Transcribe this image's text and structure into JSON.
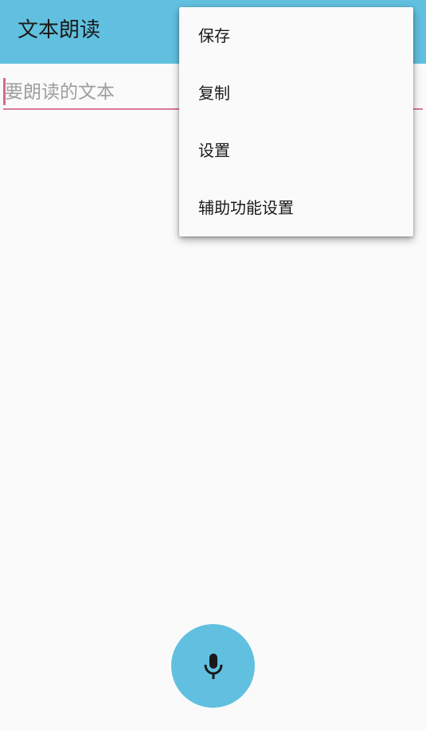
{
  "app": {
    "title": "文本朗读"
  },
  "text_field": {
    "value": "",
    "placeholder": "要朗读的文本"
  },
  "overflow_menu": {
    "items": [
      {
        "label": "保存"
      },
      {
        "label": "复制"
      },
      {
        "label": "设置"
      },
      {
        "label": "辅助功能设置"
      }
    ]
  },
  "fab": {
    "icon": "microphone-icon"
  },
  "colors": {
    "accent": "#61c0df",
    "cursor": "#d8678d",
    "background": "#fafafa"
  }
}
